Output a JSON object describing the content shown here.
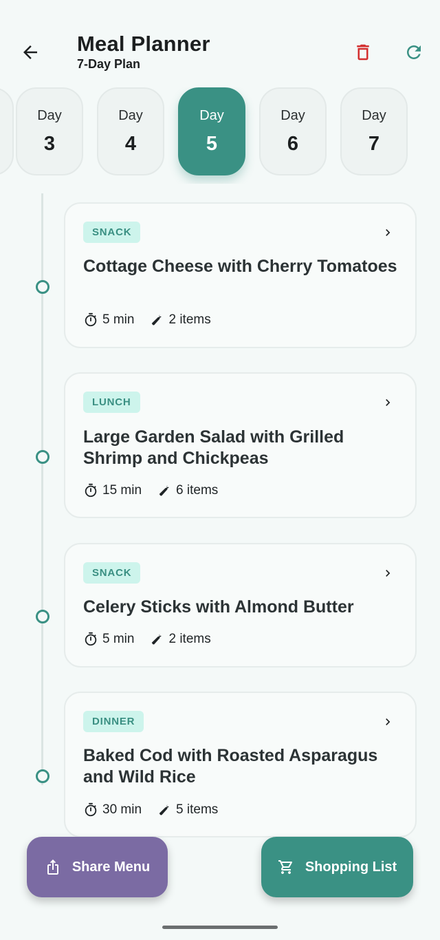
{
  "header": {
    "title": "Meal Planner",
    "subtitle": "7-Day Plan",
    "back_icon": "arrow-left-icon",
    "delete_icon": "trash-icon",
    "refresh_icon": "refresh-icon",
    "delete_color": "#d32f2f",
    "refresh_color": "#3a9184"
  },
  "days": [
    {
      "label": "Day",
      "number": "3",
      "active": false
    },
    {
      "label": "Day",
      "number": "4",
      "active": false
    },
    {
      "label": "Day",
      "number": "5",
      "active": true
    },
    {
      "label": "Day",
      "number": "6",
      "active": false
    },
    {
      "label": "Day",
      "number": "7",
      "active": false
    }
  ],
  "meals": [
    {
      "type": "SNACK",
      "title": "Cottage Cheese with Cherry Tomatoes",
      "time": "5 min",
      "items": "2 items"
    },
    {
      "type": "LUNCH",
      "title": "Large Garden Salad with Grilled Shrimp and Chickpeas",
      "time": "15 min",
      "items": "6 items"
    },
    {
      "type": "SNACK",
      "title": "Celery Sticks with Almond Butter",
      "time": "5 min",
      "items": "2 items"
    },
    {
      "type": "DINNER",
      "title": "Baked Cod with Roasted Asparagus and Wild Rice",
      "time": "30 min",
      "items": "5 items"
    }
  ],
  "actions": {
    "share_label": "Share Menu",
    "shopping_label": "Shopping List",
    "share_icon": "share-icon",
    "shopping_icon": "cart-icon"
  },
  "colors": {
    "accent": "#3a9184",
    "share": "#7b6ba3",
    "badge_bg": "#cdf4ec",
    "background": "#f4f9f8"
  }
}
